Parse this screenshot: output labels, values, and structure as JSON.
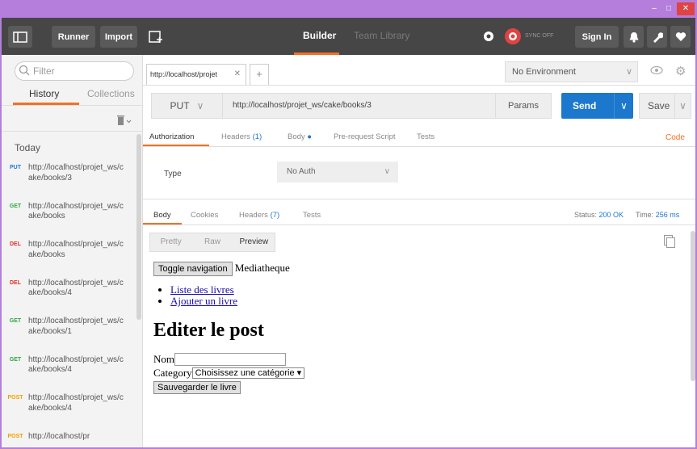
{
  "window": {
    "controls": [
      "–",
      "□",
      "✕"
    ]
  },
  "toolbar": {
    "runner_label": "Runner",
    "import_label": "Import",
    "builder_label": "Builder",
    "team_label": "Team Library",
    "sync_label": "SYNC OFF",
    "signin_label": "Sign In"
  },
  "sidebar": {
    "filter_placeholder": "Filter",
    "tab_history": "History",
    "tab_collections": "Collections",
    "group_label": "Today",
    "items": [
      {
        "method": "PUT",
        "color": "#1c78cd",
        "url": "http://localhost/projet_ws/cake/books/3"
      },
      {
        "method": "GET",
        "color": "#2fa541",
        "url": "http://localhost/projet_ws/cake/books"
      },
      {
        "method": "DEL",
        "color": "#d9302c",
        "url": "http://localhost/projet_ws/cake/books"
      },
      {
        "method": "DEL",
        "color": "#d9302c",
        "url": "http://localhost/projet_ws/cake/books/4"
      },
      {
        "method": "GET",
        "color": "#2fa541",
        "url": "http://localhost/projet_ws/cake/books/1"
      },
      {
        "method": "GET",
        "color": "#2fa541",
        "url": "http://localhost/projet_ws/cake/books/4"
      },
      {
        "method": "POST",
        "color": "#f0a000",
        "url": "http://localhost/projet_ws/cake/books/4"
      },
      {
        "method": "POST",
        "color": "#f0a000",
        "url": "http://localhost/pr"
      }
    ]
  },
  "request": {
    "tab_title": "http://localhost/projet",
    "tab_close": "✕",
    "new_tab": "+",
    "environment": "No Environment",
    "method": "PUT",
    "url": "http://localhost/projet_ws/cake/books/3",
    "params_label": "Params",
    "send_label": "Send",
    "save_label": "Save",
    "tabs": {
      "authorization": "Authorization",
      "headers": "Headers",
      "headers_count": "(1)",
      "body": "Body",
      "prerequest": "Pre-request Script",
      "tests": "Tests"
    },
    "code_label": "Code",
    "auth_type_label": "Type",
    "auth_type_value": "No Auth"
  },
  "response": {
    "tabs": {
      "body": "Body",
      "cookies": "Cookies",
      "headers": "Headers",
      "headers_count": "(7)",
      "tests": "Tests"
    },
    "status_label": "Status:",
    "status_value": "200 OK",
    "time_label": "Time:",
    "time_value": "256 ms",
    "view_pretty": "Pretty",
    "view_raw": "Raw",
    "view_preview": "Preview"
  },
  "preview": {
    "toggle_nav": "Toggle navigation",
    "brand": "Mediatheque",
    "links": [
      "Liste des livres",
      "Ajouter un livre"
    ],
    "heading": "Editer le post",
    "nom_label": "Nom",
    "category_label": "Category",
    "category_value": "Choisissez une catégorie ▾",
    "submit_label": "Sauvegarder le livre"
  }
}
